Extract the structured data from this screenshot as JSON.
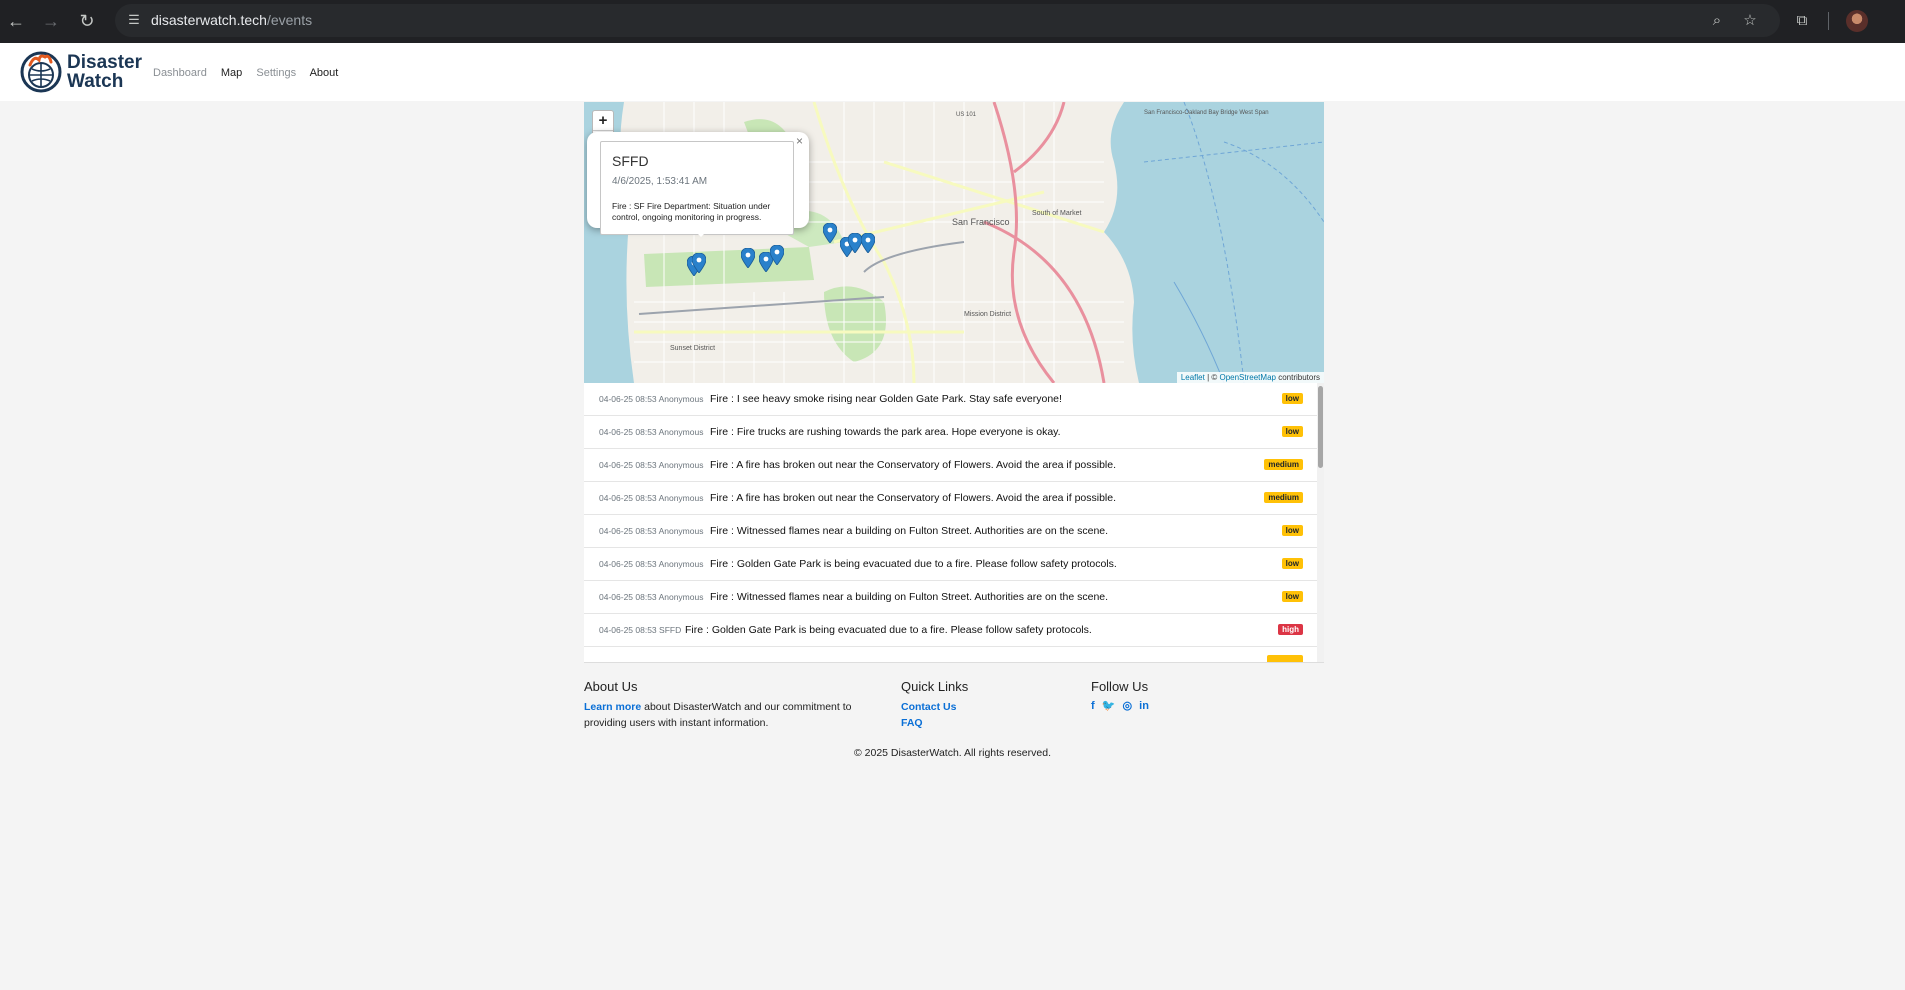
{
  "browser": {
    "url_host": "disasterwatch.tech",
    "url_path": "/events"
  },
  "header": {
    "brand_line1": "Disaster",
    "brand_line2": "Watch",
    "nav": [
      "Dashboard",
      "Map",
      "Settings",
      "About"
    ]
  },
  "map": {
    "popup": {
      "title": "SFFD",
      "time": "4/6/2025, 1:53:41 AM",
      "body": "Fire : SF Fire Department: Situation under control, ongoing monitoring in progress."
    },
    "labels": {
      "city": "San Francisco",
      "soma": "South of Market",
      "mission": "Mission District",
      "sunset": "Sunset District",
      "us101": "US 101",
      "oakland": "San Francisco-Oakland Bay Bridge West Span"
    },
    "attribution": {
      "leaflet": "Leaflet",
      "sep": " | © ",
      "osm": "OpenStreetMap",
      "suffix": " contributors"
    },
    "zoom_in": "+",
    "zoom_out": "−",
    "popup_close": "×"
  },
  "feed": [
    {
      "date": "04-06-25 08:53",
      "user": "Anonymous",
      "text": "Fire : I see heavy smoke rising near Golden Gate Park. Stay safe everyone!",
      "severity": "low"
    },
    {
      "date": "04-06-25 08:53",
      "user": "Anonymous",
      "text": "Fire : Fire trucks are rushing towards the park area. Hope everyone is okay.",
      "severity": "low"
    },
    {
      "date": "04-06-25 08:53",
      "user": "Anonymous",
      "text": "Fire : A fire has broken out near the Conservatory of Flowers. Avoid the area if possible.",
      "severity": "medium"
    },
    {
      "date": "04-06-25 08:53",
      "user": "Anonymous",
      "text": "Fire : A fire has broken out near the Conservatory of Flowers. Avoid the area if possible.",
      "severity": "medium"
    },
    {
      "date": "04-06-25 08:53",
      "user": "Anonymous",
      "text": "Fire : Witnessed flames near a building on Fulton Street. Authorities are on the scene.",
      "severity": "low"
    },
    {
      "date": "04-06-25 08:53",
      "user": "Anonymous",
      "text": "Fire : Golden Gate Park is being evacuated due to a fire. Please follow safety protocols.",
      "severity": "low"
    },
    {
      "date": "04-06-25 08:53",
      "user": "Anonymous",
      "text": "Fire : Witnessed flames near a building on Fulton Street. Authorities are on the scene.",
      "severity": "low"
    },
    {
      "date": "04-06-25 08:53",
      "user": "SFFD",
      "text": "Fire : Golden Gate Park is being evacuated due to a fire. Please follow safety protocols.",
      "severity": "high"
    }
  ],
  "footer": {
    "about_title": "About Us",
    "about_link": "Learn more",
    "about_text_1": " about DisasterWatch and our commitment to",
    "about_text_2": "providing users with instant information.",
    "links_title": "Quick Links",
    "links": [
      "Contact Us",
      "FAQ"
    ],
    "follow_title": "Follow Us",
    "social": [
      "f",
      "t",
      "ig",
      "in"
    ],
    "copyright": "© 2025 DisasterWatch. All rights reserved."
  },
  "colors": {
    "accent": "#0a6fd6",
    "low": "#ffc107",
    "medium": "#ffc107",
    "high": "#dc3545",
    "marker": "#2a81cb"
  }
}
